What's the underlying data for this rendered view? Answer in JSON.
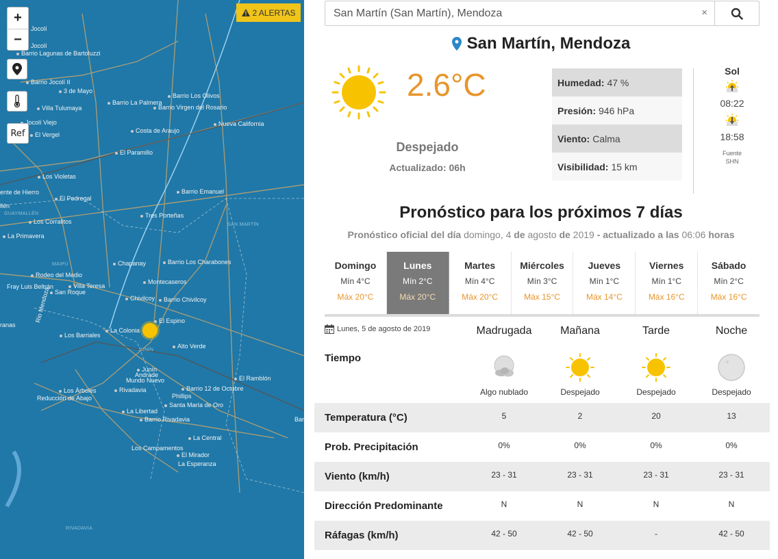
{
  "map": {
    "alerts_label": "2 ALERTAS",
    "zoom_in": "+",
    "zoom_out": "−",
    "ref_label": "Ref",
    "towns": [
      "Jocolí",
      "Jocolí",
      "Barrio Lagunas de Bartoluzzi",
      "Barrio Jocolí II",
      "3 de Mayo",
      "Barrio Los Olivos",
      "Barrio La Palmera",
      "Barrio Virgen del Rosario",
      "Villa Tulumaya",
      "Jocolí Viejo",
      "Nueva California",
      "Costa de Araujo",
      "El Vergel",
      "El Paramillo",
      "Los Violetas",
      "El Pedregal",
      "ente de Hierro",
      "Barrio Emanuel",
      "llén",
      "Los Corralitos",
      "Tres Porteñas",
      "La Primavera",
      "Chapanay",
      "Barrio Los Charabones",
      "Rodeo del Medio",
      "Montecaseros",
      "Fray Luis Beltrán",
      "Villa Teresa",
      "San Roque",
      "Chivilcoy",
      "Barrio Chivilcoy",
      "ranas",
      "El Espino",
      "Los Barriales",
      "La Colonia",
      "Alto Verde",
      "Junín",
      "Andrade",
      "Mundo Nuevo",
      "El Ramblón",
      "Los Árboles",
      "Rivadavia",
      "Barrio 12 de Octubre",
      "Reducción de Abajo",
      "Phillips",
      "Santa María de Oro",
      "La Libertad",
      "Barrio Rivadavia",
      "La Central",
      "Los Campamentos",
      "El Mirador",
      "La Esperanza",
      "Bar",
      "Rio Mendoza"
    ],
    "regions": [
      "GUAYMALLÉN",
      "MAIPÚ",
      "SAN MARTÍN",
      "JUNÍN",
      "RIVADAVIA"
    ]
  },
  "search": {
    "value": "San Martín (San Martín), Mendoza",
    "clear": "×"
  },
  "location": {
    "title": "San Martín, Mendoza"
  },
  "current": {
    "temperature": "2.6°C",
    "description": "Despejado",
    "updated": "Actualizado: 06h"
  },
  "stats": [
    {
      "label": "Humedad:",
      "value": "47 %"
    },
    {
      "label": "Presión:",
      "value": "946 hPa"
    },
    {
      "label": "Viento:",
      "value": "Calma"
    },
    {
      "label": "Visibilidad:",
      "value": "15 km"
    }
  ],
  "sol": {
    "header": "Sol",
    "sunrise": "08:22",
    "sunset": "18:58",
    "source_1": "Fuente",
    "source_2": "SHN"
  },
  "forecast": {
    "title": "Pronóstico para los próximos 7 días",
    "sub": {
      "p1": "Pronóstico oficial del día",
      "p2": "domingo, 4",
      "p3": "de",
      "p4": "agosto",
      "p5": "de",
      "p6": "2019",
      "p7": "- actualizado a las",
      "p8": "06:06",
      "p9": "horas"
    },
    "days": [
      {
        "name": "Domingo",
        "min": "Mín 4°C",
        "max": "Máx 20°C",
        "active": false
      },
      {
        "name": "Lunes",
        "min": "Mín 2°C",
        "max": "Máx 20°C",
        "active": true
      },
      {
        "name": "Martes",
        "min": "Mín 4°C",
        "max": "Máx 20°C",
        "active": false
      },
      {
        "name": "Miércoles",
        "min": "Mín 3°C",
        "max": "Máx 15°C",
        "active": false
      },
      {
        "name": "Jueves",
        "min": "Mín 1°C",
        "max": "Máx 14°C",
        "active": false
      },
      {
        "name": "Viernes",
        "min": "Mín 1°C",
        "max": "Máx 16°C",
        "active": false
      },
      {
        "name": "Sábado",
        "min": "Mín 2°C",
        "max": "Máx 16°C",
        "active": false
      }
    ]
  },
  "detail": {
    "date": "Lunes, 5 de agosto de 2019",
    "periods": [
      "Madrugada",
      "Mañana",
      "Tarde",
      "Noche"
    ],
    "tiempo_label": "Tiempo",
    "weather": [
      {
        "icon": "partly-cloudy-night-icon",
        "caption": "Algo nublado"
      },
      {
        "icon": "sun-icon",
        "caption": "Despejado"
      },
      {
        "icon": "sun-icon",
        "caption": "Despejado"
      },
      {
        "icon": "moon-icon",
        "caption": "Despejado"
      }
    ],
    "rows": [
      {
        "label": "Temperatura (°C)",
        "values": [
          "5",
          "2",
          "20",
          "13"
        ]
      },
      {
        "label": "Prob. Precipitación",
        "values": [
          "0%",
          "0%",
          "0%",
          "0%"
        ]
      },
      {
        "label": "Viento (km/h)",
        "values": [
          "23 - 31",
          "23 - 31",
          "23 - 31",
          "23 - 31"
        ]
      },
      {
        "label": "Dirección Predominante",
        "values": [
          "N",
          "N",
          "N",
          "N"
        ]
      },
      {
        "label": "Ráfagas (km/h)",
        "values": [
          "42 - 50",
          "42 - 50",
          "-",
          "42 - 50"
        ]
      }
    ]
  },
  "colors": {
    "map_bg": "#1f78a8",
    "accent_orange": "#e8952b",
    "sun_yellow": "#f7c300",
    "alert_yellow": "#f0c419"
  }
}
